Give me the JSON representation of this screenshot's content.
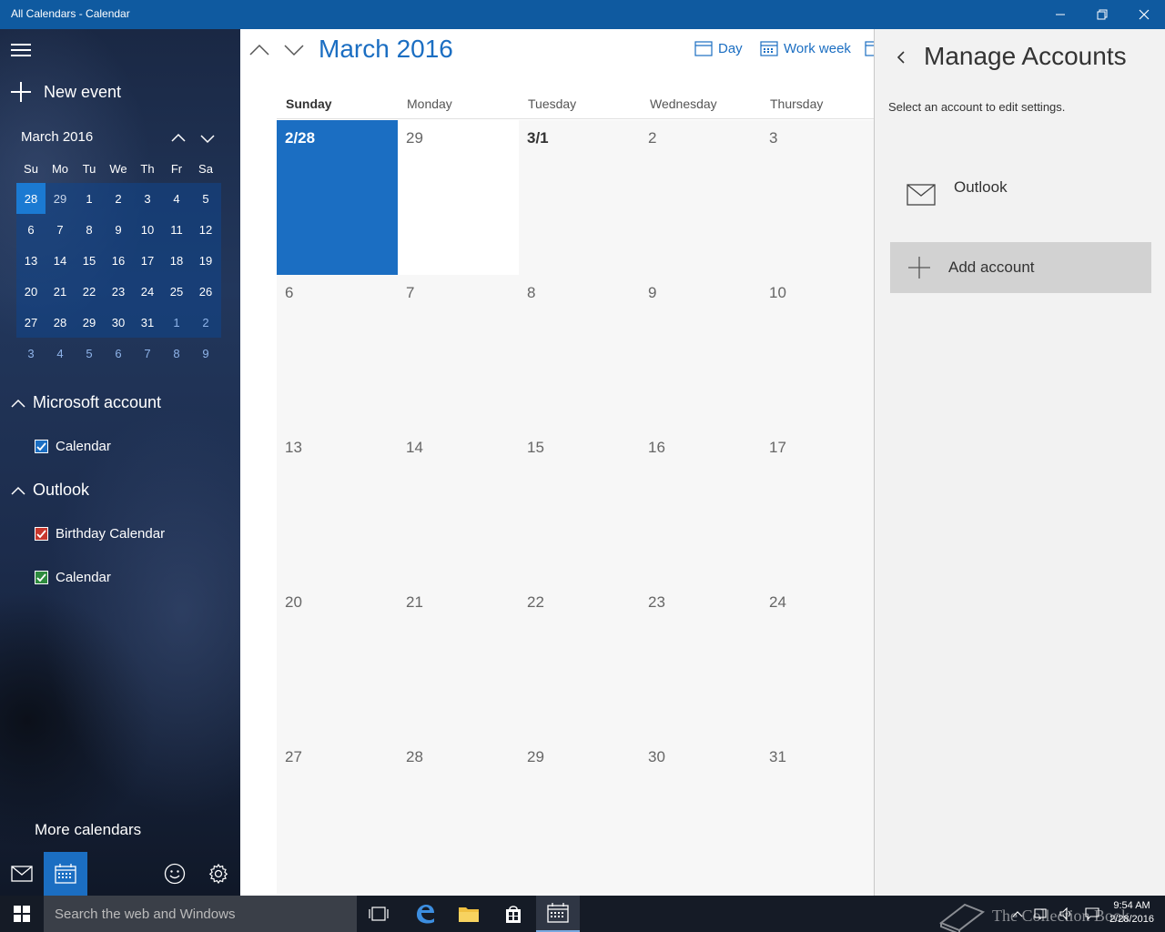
{
  "window": {
    "title": "All Calendars - Calendar"
  },
  "sidebar": {
    "new_event_label": "New event",
    "mini_calendar": {
      "title": "March 2016",
      "weekday_heads": [
        "Su",
        "Mo",
        "Tu",
        "We",
        "Th",
        "Fr",
        "Sa"
      ],
      "weeks": [
        [
          "28",
          "29",
          "1",
          "2",
          "3",
          "4",
          "5"
        ],
        [
          "6",
          "7",
          "8",
          "9",
          "10",
          "11",
          "12"
        ],
        [
          "13",
          "14",
          "15",
          "16",
          "17",
          "18",
          "19"
        ],
        [
          "20",
          "21",
          "22",
          "23",
          "24",
          "25",
          "26"
        ],
        [
          "27",
          "28",
          "29",
          "30",
          "31",
          "1",
          "2"
        ],
        [
          "3",
          "4",
          "5",
          "6",
          "7",
          "8",
          "9"
        ]
      ],
      "today": "28"
    },
    "groups": [
      {
        "name": "Microsoft account",
        "calendars": [
          {
            "label": "Calendar",
            "color": "#1b6ec2",
            "checked": true
          }
        ]
      },
      {
        "name": "Outlook",
        "calendars": [
          {
            "label": "Birthday Calendar",
            "color": "#c8372d",
            "checked": true
          },
          {
            "label": "Calendar",
            "color": "#2e8b3e",
            "checked": true
          }
        ]
      }
    ],
    "more_calendars_label": "More calendars",
    "bottom_icons": [
      "mail-icon",
      "calendar-icon",
      "smiley-icon",
      "gear-icon"
    ]
  },
  "main": {
    "month_title": "March 2016",
    "views": {
      "day": "Day",
      "work_week": "Work week"
    },
    "weekdays": [
      "Sunday",
      "Monday",
      "Tuesday",
      "Wednesday",
      "Thursday"
    ],
    "weeks": [
      [
        "2/28",
        "29",
        "3/1",
        "2",
        "3"
      ],
      [
        "6",
        "7",
        "8",
        "9",
        "10"
      ],
      [
        "13",
        "14",
        "15",
        "16",
        "17"
      ],
      [
        "20",
        "21",
        "22",
        "23",
        "24"
      ],
      [
        "27",
        "28",
        "29",
        "30",
        "31"
      ]
    ],
    "accent_color": "#1b6ec2"
  },
  "panel": {
    "title": "Manage Accounts",
    "subtitle": "Select an account to edit settings.",
    "accounts": [
      {
        "name": "Outlook",
        "icon": "mail-icon"
      }
    ],
    "add_account_label": "Add account"
  },
  "taskbar": {
    "search_placeholder": "Search the web and Windows",
    "clock_time": "9:54 AM",
    "clock_date": "2/28/2016",
    "watermark": "The Collection Book"
  }
}
